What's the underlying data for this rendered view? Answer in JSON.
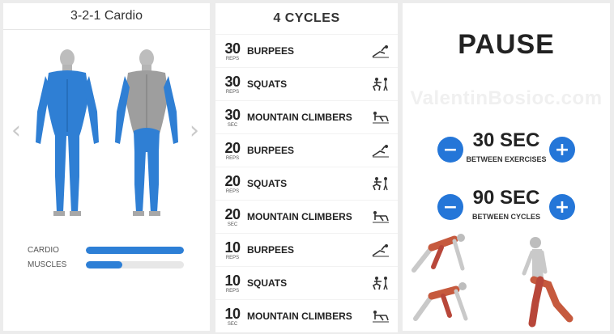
{
  "left_panel": {
    "title": "3-2-1 Cardio",
    "prev_icon": "chevron-left-icon",
    "next_icon": "chevron-right-icon",
    "bars": [
      {
        "label": "CARDIO",
        "value": 1.0
      },
      {
        "label": "MUSCLES",
        "value": 0.37
      }
    ],
    "muscle_color": "#2f7fd4"
  },
  "middle_panel": {
    "title": "4 CYCLES",
    "exercises": [
      {
        "count": "30",
        "unit": "REPS",
        "name": "BURPEES",
        "icon": "burpee-icon"
      },
      {
        "count": "30",
        "unit": "REPS",
        "name": "SQUATS",
        "icon": "squat-icon"
      },
      {
        "count": "30",
        "unit": "SEC",
        "name": "MOUNTAIN CLIMBERS",
        "icon": "mountain-climber-icon"
      },
      {
        "count": "20",
        "unit": "REPS",
        "name": "BURPEES",
        "icon": "burpee-icon"
      },
      {
        "count": "20",
        "unit": "REPS",
        "name": "SQUATS",
        "icon": "squat-icon"
      },
      {
        "count": "20",
        "unit": "SEC",
        "name": "MOUNTAIN CLIMBERS",
        "icon": "mountain-climber-icon"
      },
      {
        "count": "10",
        "unit": "REPS",
        "name": "BURPEES",
        "icon": "burpee-icon"
      },
      {
        "count": "10",
        "unit": "REPS",
        "name": "SQUATS",
        "icon": "squat-icon"
      },
      {
        "count": "10",
        "unit": "SEC",
        "name": "MOUNTAIN CLIMBERS",
        "icon": "mountain-climber-icon"
      }
    ]
  },
  "right_panel": {
    "title": "PAUSE",
    "watermark": "ValentinBosioc.com",
    "exercise_pause": {
      "value": "30 SEC",
      "label": "BETWEEN EXERCISES",
      "minus": "−",
      "plus": "+"
    },
    "cycle_pause": {
      "value": "90 SEC",
      "label": "BETWEEN CYCLES",
      "minus": "−",
      "plus": "+"
    },
    "accent_color": "#2476d8"
  }
}
